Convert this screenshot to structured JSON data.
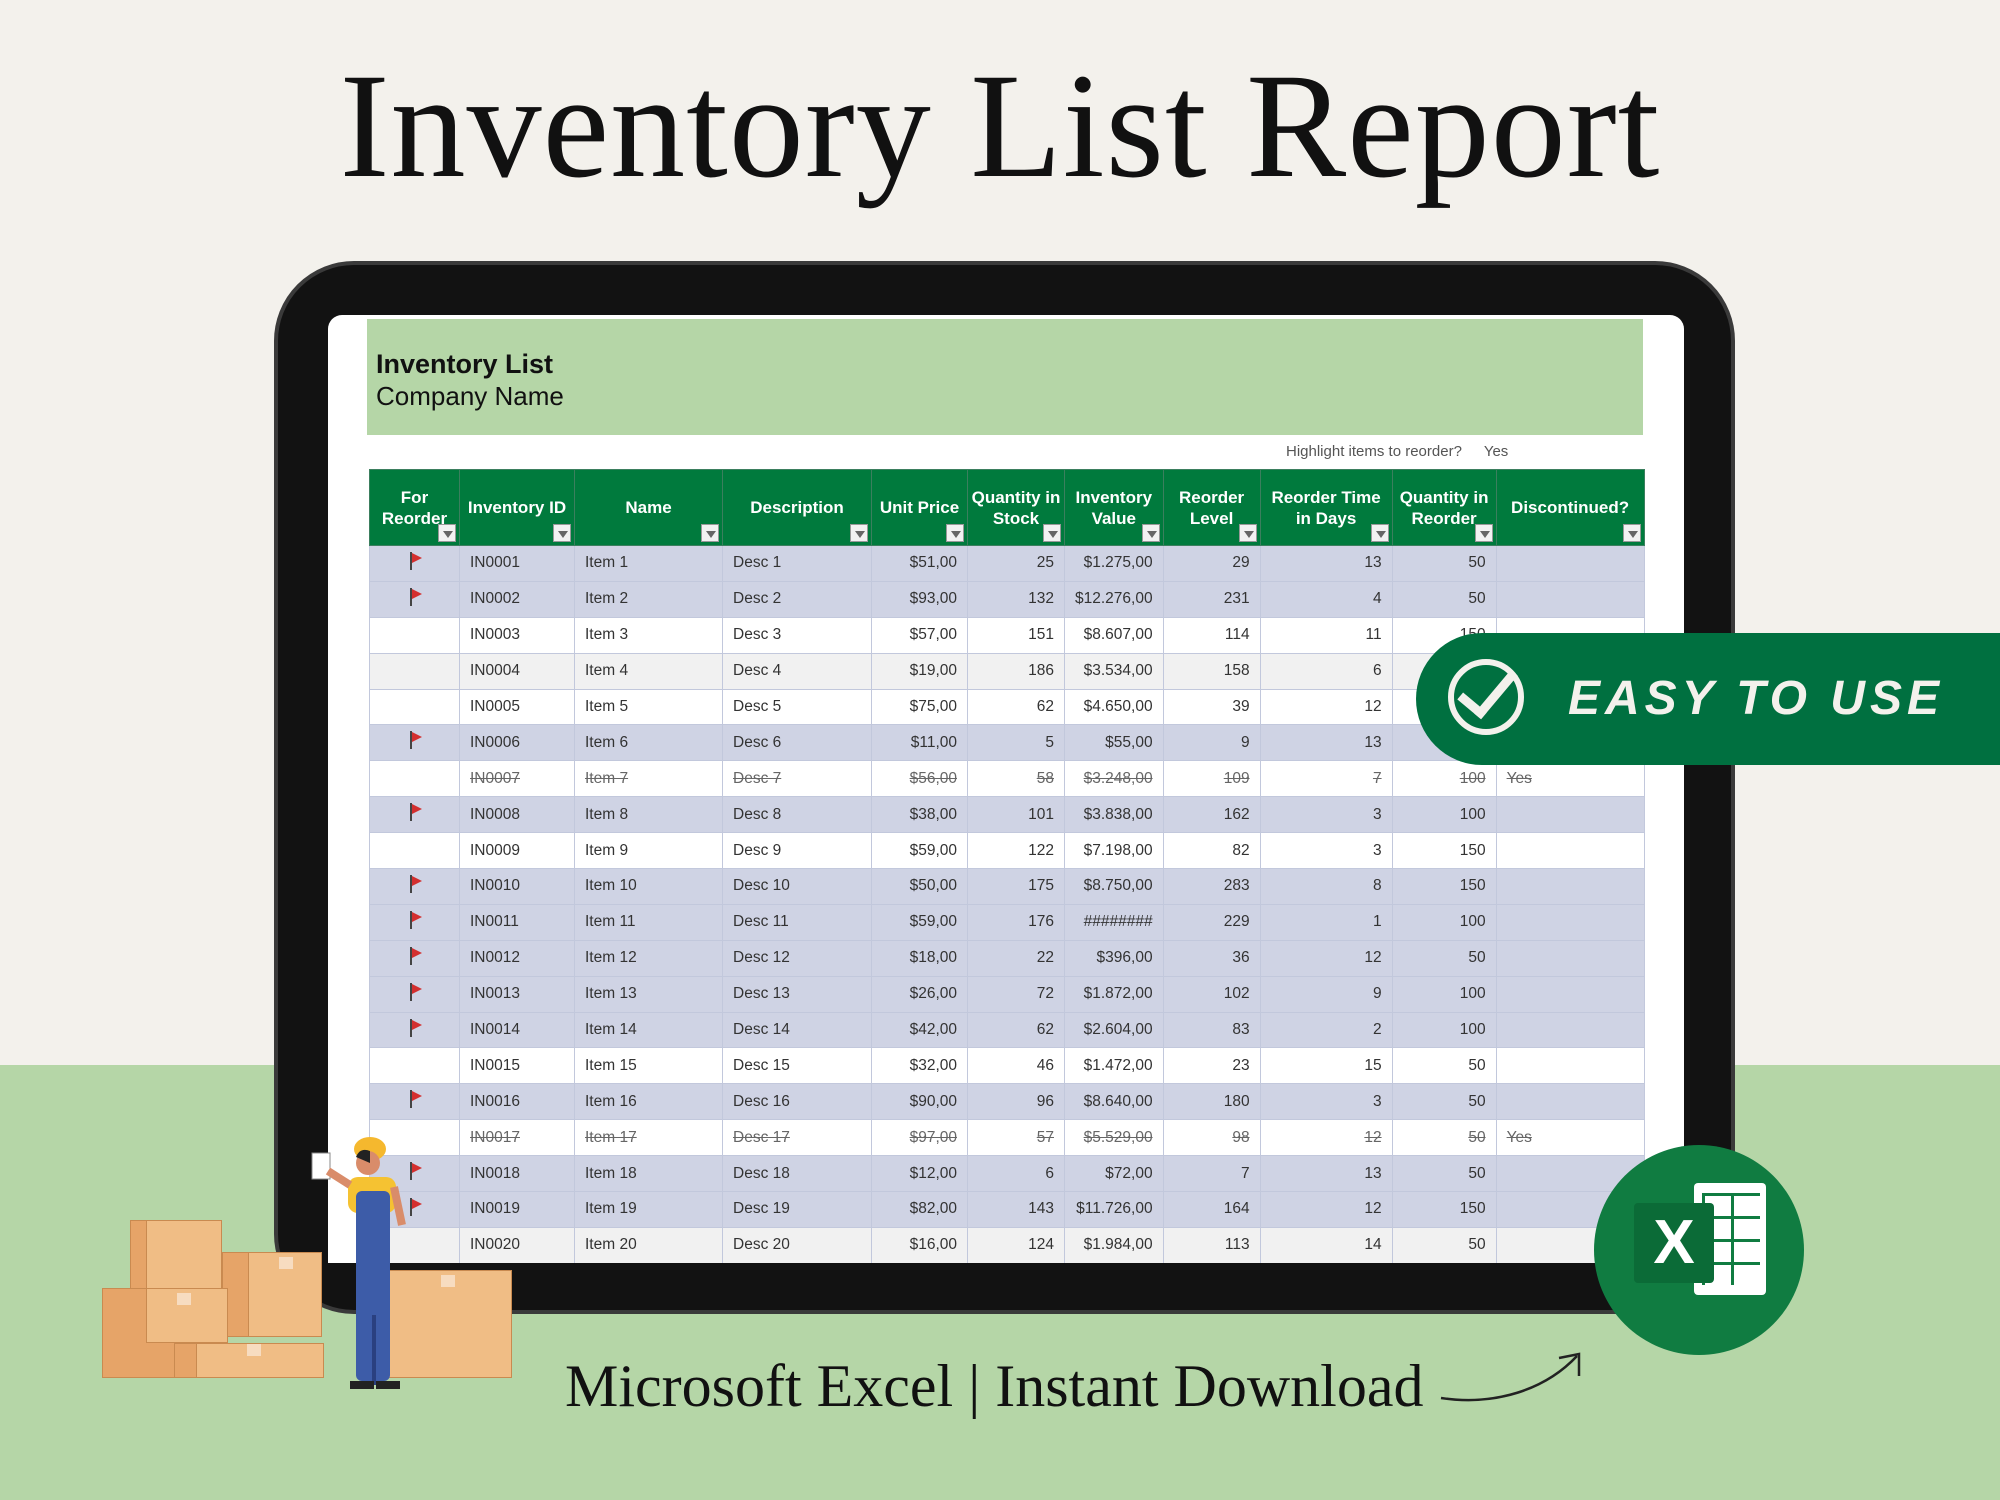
{
  "title": "Inventory List Report",
  "sheet": {
    "title": "Inventory List",
    "company": "Company Name",
    "highlight_label": "Highlight items to reorder?",
    "highlight_value": "Yes"
  },
  "columns": [
    "For Reorder",
    "Inventory ID",
    "Name",
    "Description",
    "Unit Price",
    "Quantity in Stock",
    "Inventory Value",
    "Reorder Level",
    "Reorder Time in Days",
    "Quantity in Reorder",
    "Discontinued?"
  ],
  "rows": [
    {
      "flag": true,
      "id": "IN0001",
      "name": "Item 1",
      "desc": "Desc 1",
      "price": "$51,00",
      "qty": "25",
      "value": "$1.275,00",
      "level": "29",
      "days": "13",
      "reorder": "50",
      "disc": ""
    },
    {
      "flag": true,
      "id": "IN0002",
      "name": "Item 2",
      "desc": "Desc 2",
      "price": "$93,00",
      "qty": "132",
      "value": "$12.276,00",
      "level": "231",
      "days": "4",
      "reorder": "50",
      "disc": ""
    },
    {
      "flag": false,
      "id": "IN0003",
      "name": "Item 3",
      "desc": "Desc 3",
      "price": "$57,00",
      "qty": "151",
      "value": "$8.607,00",
      "level": "114",
      "days": "11",
      "reorder": "150",
      "disc": ""
    },
    {
      "flag": false,
      "id": "IN0004",
      "name": "Item 4",
      "desc": "Desc 4",
      "price": "$19,00",
      "qty": "186",
      "value": "$3.534,00",
      "level": "158",
      "days": "6",
      "reorder": "",
      "disc": ""
    },
    {
      "flag": false,
      "id": "IN0005",
      "name": "Item 5",
      "desc": "Desc 5",
      "price": "$75,00",
      "qty": "62",
      "value": "$4.650,00",
      "level": "39",
      "days": "12",
      "reorder": "",
      "disc": ""
    },
    {
      "flag": true,
      "id": "IN0006",
      "name": "Item 6",
      "desc": "Desc 6",
      "price": "$11,00",
      "qty": "5",
      "value": "$55,00",
      "level": "9",
      "days": "13",
      "reorder": "",
      "disc": ""
    },
    {
      "flag": false,
      "id": "IN0007",
      "name": "Item 7",
      "desc": "Desc 7",
      "price": "$56,00",
      "qty": "58",
      "value": "$3.248,00",
      "level": "109",
      "days": "7",
      "reorder": "100",
      "disc": "Yes"
    },
    {
      "flag": true,
      "id": "IN0008",
      "name": "Item 8",
      "desc": "Desc 8",
      "price": "$38,00",
      "qty": "101",
      "value": "$3.838,00",
      "level": "162",
      "days": "3",
      "reorder": "100",
      "disc": ""
    },
    {
      "flag": false,
      "id": "IN0009",
      "name": "Item 9",
      "desc": "Desc 9",
      "price": "$59,00",
      "qty": "122",
      "value": "$7.198,00",
      "level": "82",
      "days": "3",
      "reorder": "150",
      "disc": ""
    },
    {
      "flag": true,
      "id": "IN0010",
      "name": "Item 10",
      "desc": "Desc 10",
      "price": "$50,00",
      "qty": "175",
      "value": "$8.750,00",
      "level": "283",
      "days": "8",
      "reorder": "150",
      "disc": ""
    },
    {
      "flag": true,
      "id": "IN0011",
      "name": "Item 11",
      "desc": "Desc 11",
      "price": "$59,00",
      "qty": "176",
      "value": "########",
      "level": "229",
      "days": "1",
      "reorder": "100",
      "disc": ""
    },
    {
      "flag": true,
      "id": "IN0012",
      "name": "Item 12",
      "desc": "Desc 12",
      "price": "$18,00",
      "qty": "22",
      "value": "$396,00",
      "level": "36",
      "days": "12",
      "reorder": "50",
      "disc": ""
    },
    {
      "flag": true,
      "id": "IN0013",
      "name": "Item 13",
      "desc": "Desc 13",
      "price": "$26,00",
      "qty": "72",
      "value": "$1.872,00",
      "level": "102",
      "days": "9",
      "reorder": "100",
      "disc": ""
    },
    {
      "flag": true,
      "id": "IN0014",
      "name": "Item 14",
      "desc": "Desc 14",
      "price": "$42,00",
      "qty": "62",
      "value": "$2.604,00",
      "level": "83",
      "days": "2",
      "reorder": "100",
      "disc": ""
    },
    {
      "flag": false,
      "id": "IN0015",
      "name": "Item 15",
      "desc": "Desc 15",
      "price": "$32,00",
      "qty": "46",
      "value": "$1.472,00",
      "level": "23",
      "days": "15",
      "reorder": "50",
      "disc": ""
    },
    {
      "flag": true,
      "id": "IN0016",
      "name": "Item 16",
      "desc": "Desc 16",
      "price": "$90,00",
      "qty": "96",
      "value": "$8.640,00",
      "level": "180",
      "days": "3",
      "reorder": "50",
      "disc": ""
    },
    {
      "flag": false,
      "id": "IN0017",
      "name": "Item 17",
      "desc": "Desc 17",
      "price": "$97,00",
      "qty": "57",
      "value": "$5.529,00",
      "level": "98",
      "days": "12",
      "reorder": "50",
      "disc": "Yes"
    },
    {
      "flag": true,
      "id": "IN0018",
      "name": "Item 18",
      "desc": "Desc 18",
      "price": "$12,00",
      "qty": "6",
      "value": "$72,00",
      "level": "7",
      "days": "13",
      "reorder": "50",
      "disc": ""
    },
    {
      "flag": true,
      "id": "IN0019",
      "name": "Item 19",
      "desc": "Desc 19",
      "price": "$82,00",
      "qty": "143",
      "value": "$11.726,00",
      "level": "164",
      "days": "12",
      "reorder": "150",
      "disc": ""
    },
    {
      "flag": false,
      "id": "IN0020",
      "name": "Item 20",
      "desc": "Desc 20",
      "price": "$16,00",
      "qty": "124",
      "value": "$1.984,00",
      "level": "113",
      "days": "14",
      "reorder": "50",
      "disc": ""
    }
  ],
  "badge": {
    "label": "EASY TO USE",
    "icon": "check-circle-icon"
  },
  "excel_logo": {
    "letter": "X",
    "color": "#107c41"
  },
  "footer": "Microsoft Excel | Instant Download",
  "colors": {
    "header_green": "#007a3d",
    "band_green": "#b5d6a7",
    "flag_row": "#cfd3e4",
    "flag": "#d32f2f",
    "badge_green": "#007040"
  }
}
